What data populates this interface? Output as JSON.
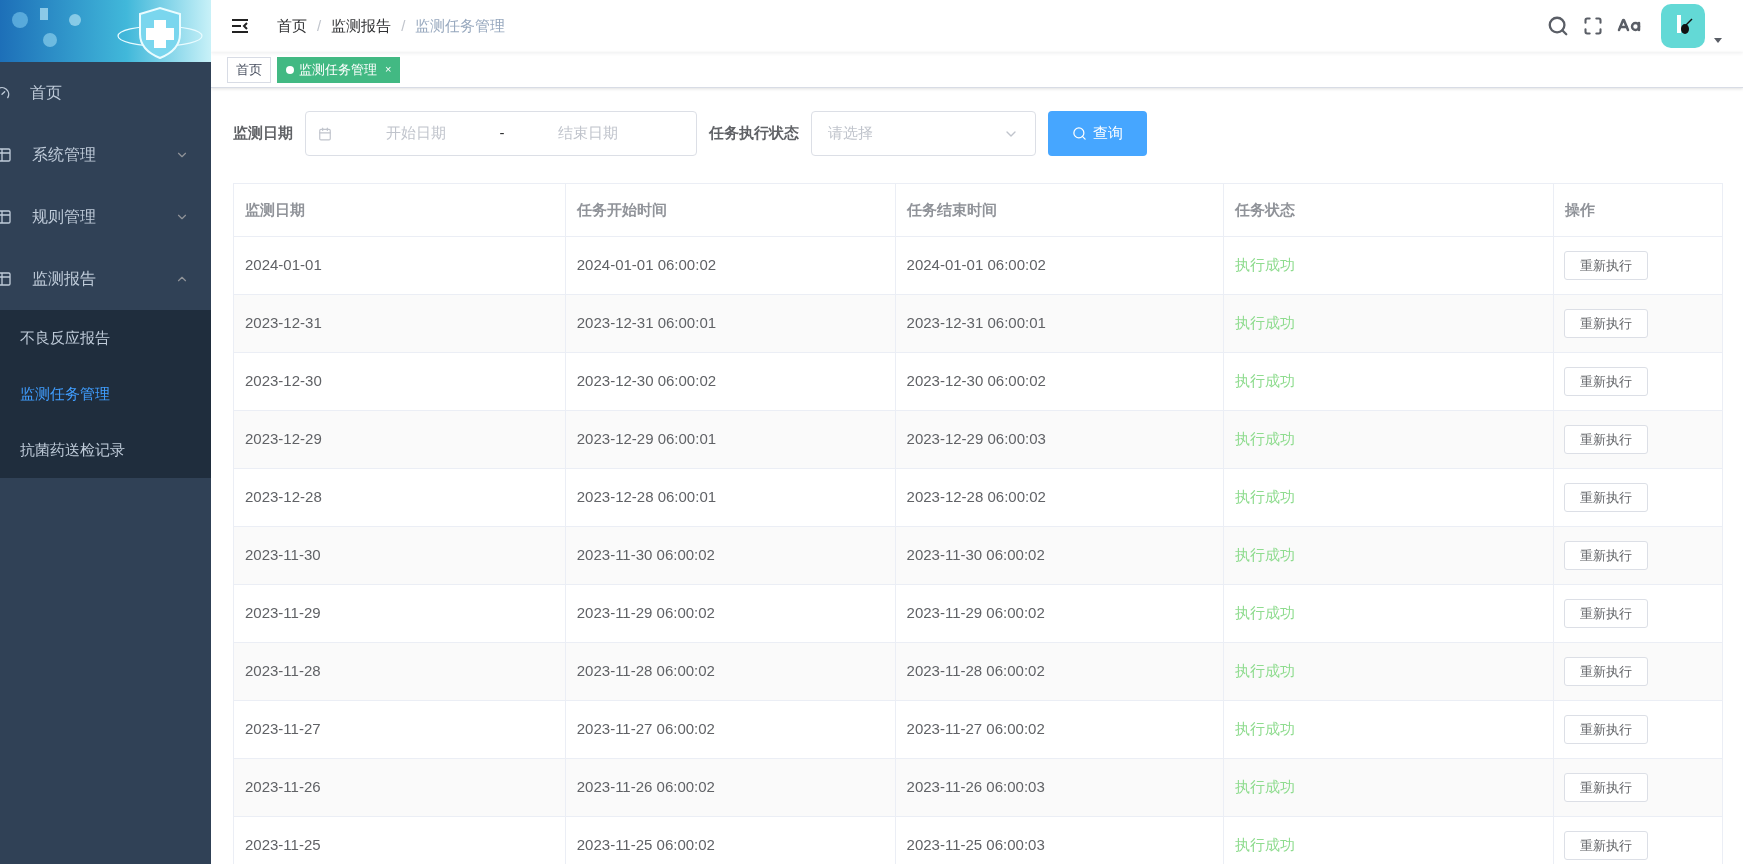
{
  "sidebar": {
    "items": [
      {
        "label": "首页",
        "kind": "link"
      },
      {
        "label": "系统管理",
        "kind": "submenu",
        "expanded": false
      },
      {
        "label": "规则管理",
        "kind": "submenu",
        "expanded": false
      },
      {
        "label": "监测报告",
        "kind": "submenu",
        "expanded": true,
        "children": [
          {
            "label": "不良反应报告",
            "selected": false
          },
          {
            "label": "监测任务管理",
            "selected": true
          },
          {
            "label": "抗菌药送检记录",
            "selected": false
          }
        ]
      }
    ]
  },
  "breadcrumb": [
    "首页",
    "监测报告",
    "监测任务管理"
  ],
  "breadcrumb_separator": "/",
  "tags": [
    {
      "label": "首页",
      "selected": false
    },
    {
      "label": "监测任务管理",
      "selected": true,
      "close": "×"
    }
  ],
  "filter": {
    "date_label": "监测日期",
    "start_placeholder": "开始日期",
    "separator": "-",
    "end_placeholder": "结束日期",
    "status_label": "任务执行状态",
    "status_placeholder": "请选择",
    "query_button": "查询"
  },
  "table": {
    "columns": [
      "监测日期",
      "任务开始时间",
      "任务结束时间",
      "任务状态",
      "操作"
    ],
    "rows": [
      {
        "date": "2024-01-01",
        "start": "2024-01-01 06:00:02",
        "end": "2024-01-01 06:00:02",
        "status": "执行成功",
        "action": "重新执行"
      },
      {
        "date": "2023-12-31",
        "start": "2023-12-31 06:00:01",
        "end": "2023-12-31 06:00:01",
        "status": "执行成功",
        "action": "重新执行"
      },
      {
        "date": "2023-12-30",
        "start": "2023-12-30 06:00:02",
        "end": "2023-12-30 06:00:02",
        "status": "执行成功",
        "action": "重新执行"
      },
      {
        "date": "2023-12-29",
        "start": "2023-12-29 06:00:01",
        "end": "2023-12-29 06:00:03",
        "status": "执行成功",
        "action": "重新执行"
      },
      {
        "date": "2023-12-28",
        "start": "2023-12-28 06:00:01",
        "end": "2023-12-28 06:00:02",
        "status": "执行成功",
        "action": "重新执行"
      },
      {
        "date": "2023-11-30",
        "start": "2023-11-30 06:00:02",
        "end": "2023-11-30 06:00:02",
        "status": "执行成功",
        "action": "重新执行"
      },
      {
        "date": "2023-11-29",
        "start": "2023-11-29 06:00:02",
        "end": "2023-11-29 06:00:02",
        "status": "执行成功",
        "action": "重新执行"
      },
      {
        "date": "2023-11-28",
        "start": "2023-11-28 06:00:02",
        "end": "2023-11-28 06:00:02",
        "status": "执行成功",
        "action": "重新执行"
      },
      {
        "date": "2023-11-27",
        "start": "2023-11-27 06:00:02",
        "end": "2023-11-27 06:00:02",
        "status": "执行成功",
        "action": "重新执行"
      },
      {
        "date": "2023-11-26",
        "start": "2023-11-26 06:00:02",
        "end": "2023-11-26 06:00:03",
        "status": "执行成功",
        "action": "重新执行"
      },
      {
        "date": "2023-11-25",
        "start": "2023-11-25 06:00:02",
        "end": "2023-11-25 06:00:03",
        "status": "执行成功",
        "action": "重新执行"
      }
    ]
  }
}
